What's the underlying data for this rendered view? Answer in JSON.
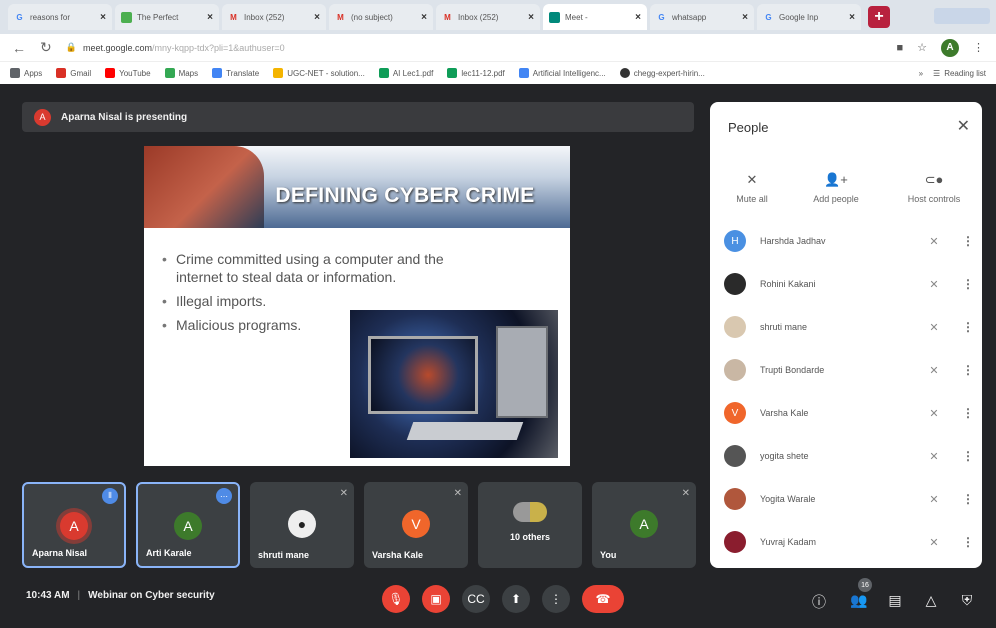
{
  "browser": {
    "tabs": [
      {
        "label": "reasons for",
        "icon": "google-icon",
        "color": "#4285f4"
      },
      {
        "label": "The Perfect",
        "icon": "image-icon",
        "color": "#4caf50"
      },
      {
        "label": "Inbox (252)",
        "icon": "gmail-icon",
        "color": "#d93025"
      },
      {
        "label": "(no subject)",
        "icon": "gmail-icon",
        "color": "#d93025"
      },
      {
        "label": "Inbox (252)",
        "icon": "gmail-icon",
        "color": "#d93025"
      },
      {
        "label": "Meet -",
        "icon": "meet-icon",
        "color": "#00897b"
      },
      {
        "label": "whatsapp",
        "icon": "google-icon",
        "color": "#4285f4"
      },
      {
        "label": "Google Inp",
        "icon": "google-icon",
        "color": "#4285f4"
      }
    ],
    "new_tab_label": "+",
    "url": "meet.google.com",
    "url_rest": "/mny-kqpp-tdx?pli=1&authuser=0",
    "profile_initial": "A",
    "bookmarks": [
      {
        "label": "Apps",
        "color": "#5f6368"
      },
      {
        "label": "Gmail",
        "color": "#d93025"
      },
      {
        "label": "YouTube",
        "color": "#ff0000"
      },
      {
        "label": "Maps",
        "color": "#34a853"
      },
      {
        "label": "Translate",
        "color": "#4285f4"
      },
      {
        "label": "UGC-NET - solution...",
        "color": "#f4b400"
      },
      {
        "label": "AI Lec1.pdf",
        "color": "#0f9d58"
      },
      {
        "label": "lec11-12.pdf",
        "color": "#0f9d58"
      },
      {
        "label": "Artificial Intelligenc...",
        "color": "#4285f4"
      },
      {
        "label": "chegg-expert-hirin...",
        "color": "#333333"
      }
    ],
    "bookmarks_more": "»",
    "reading_list": "Reading list"
  },
  "meet": {
    "presenting_initial": "A",
    "presenting_text": "Aparna Nisal is presenting",
    "slide": {
      "title": "DEFINING CYBER CRIME",
      "bullets": [
        "Crime committed using a computer and the internet to steal data or information.",
        "Illegal imports.",
        "Malicious programs."
      ]
    },
    "tiles": [
      {
        "name": "Aparna Nisal",
        "initial": "A",
        "color": "#d93a2f"
      },
      {
        "name": "Arti Karale",
        "initial": "A",
        "color": "#3d7a2b"
      },
      {
        "name": "shruti mane",
        "initial": "",
        "color": "#eeeeee"
      },
      {
        "name": "Varsha Kale",
        "initial": "V",
        "color": "#f0662b"
      },
      {
        "name": "10 others",
        "initial": "",
        "color": ""
      },
      {
        "name": "You",
        "initial": "A",
        "color": "#3d7a2b"
      }
    ],
    "time": "10:43 AM",
    "meeting_title": "Webinar on Cyber security",
    "participant_count": "16",
    "people_panel": {
      "title": "People",
      "actions": [
        "Mute all",
        "Add people",
        "Host controls"
      ],
      "participants": [
        {
          "name": "Harshda Jadhav",
          "initial": "H",
          "color": "#4a90e2"
        },
        {
          "name": "Rohini Kakani",
          "initial": "",
          "color": "#2a2a2a"
        },
        {
          "name": "shruti mane",
          "initial": "",
          "color": "#d9c8b0"
        },
        {
          "name": "Trupti Bondarde",
          "initial": "",
          "color": "#c9b7a4"
        },
        {
          "name": "Varsha Kale",
          "initial": "V",
          "color": "#f0662b"
        },
        {
          "name": "yogita shete",
          "initial": "",
          "color": "#555555"
        },
        {
          "name": "Yogita Warale",
          "initial": "",
          "color": "#b0573c"
        },
        {
          "name": "Yuvraj Kadam",
          "initial": "",
          "color": "#8a1d2e"
        }
      ]
    }
  }
}
